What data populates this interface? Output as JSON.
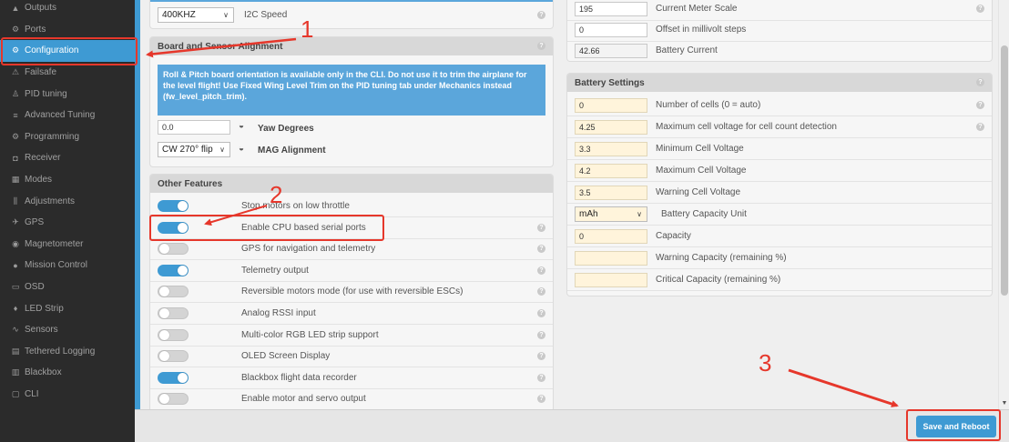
{
  "sidebar": {
    "items": [
      {
        "label": "Outputs",
        "icon": "outputs-icon",
        "glyph": "▲"
      },
      {
        "label": "Ports",
        "icon": "ports-icon",
        "glyph": "⚙"
      },
      {
        "label": "Configuration",
        "icon": "gear-icon",
        "glyph": "⚙",
        "active": true
      },
      {
        "label": "Failsafe",
        "icon": "failsafe-icon",
        "glyph": "⚠"
      },
      {
        "label": "PID tuning",
        "icon": "pid-icon",
        "glyph": "♙"
      },
      {
        "label": "Advanced Tuning",
        "icon": "advanced-tuning-icon",
        "glyph": "≡"
      },
      {
        "label": "Programming",
        "icon": "programming-icon",
        "glyph": "⚙"
      },
      {
        "label": "Receiver",
        "icon": "receiver-icon",
        "glyph": "◘"
      },
      {
        "label": "Modes",
        "icon": "modes-icon",
        "glyph": "▦"
      },
      {
        "label": "Adjustments",
        "icon": "adjustments-icon",
        "glyph": "⫼"
      },
      {
        "label": "GPS",
        "icon": "gps-icon",
        "glyph": "✈"
      },
      {
        "label": "Magnetometer",
        "icon": "magnetometer-icon",
        "glyph": "◉"
      },
      {
        "label": "Mission Control",
        "icon": "mission-control-icon",
        "glyph": "●"
      },
      {
        "label": "OSD",
        "icon": "osd-icon",
        "glyph": "▭"
      },
      {
        "label": "LED Strip",
        "icon": "led-strip-icon",
        "glyph": "♦"
      },
      {
        "label": "Sensors",
        "icon": "sensors-icon",
        "glyph": "∿"
      },
      {
        "label": "Tethered Logging",
        "icon": "tethered-logging-icon",
        "glyph": "▤"
      },
      {
        "label": "Blackbox",
        "icon": "blackbox-icon",
        "glyph": "▥"
      },
      {
        "label": "CLI",
        "icon": "cli-icon",
        "glyph": "▢"
      }
    ]
  },
  "i2c": {
    "speed_value": "400KHZ",
    "label": "I2C Speed"
  },
  "alignment": {
    "title": "Board and Sensor Alignment",
    "note": "Roll & Pitch board orientation is available only in the CLI. Do not use it to trim the airplane for the level flight! Use Fixed Wing Level Trim on the PID tuning tab under Mechanics instead (fw_level_pitch_trim).",
    "yaw_value": "0.0",
    "yaw_label": "Yaw Degrees",
    "mag_value": "CW 270° flip",
    "mag_label": "MAG Alignment"
  },
  "features": {
    "title": "Other Features",
    "items": [
      {
        "label": "Stop motors on low throttle",
        "on": true
      },
      {
        "label": "Enable CPU based serial ports",
        "on": true
      },
      {
        "label": "GPS for navigation and telemetry",
        "on": false
      },
      {
        "label": "Telemetry output",
        "on": true
      },
      {
        "label": "Reversible motors mode (for use with reversible ESCs)",
        "on": false
      },
      {
        "label": "Analog RSSI input",
        "on": false
      },
      {
        "label": "Multi-color RGB LED strip support",
        "on": false
      },
      {
        "label": "OLED Screen Display",
        "on": false
      },
      {
        "label": "Blackbox flight data recorder",
        "on": true
      },
      {
        "label": "Enable motor and servo output",
        "on": false
      }
    ]
  },
  "current": {
    "scale_value": "195",
    "scale_label": "Current Meter Scale",
    "offset_value": "0",
    "offset_label": "Offset in millivolt steps",
    "battery_current_value": "42.66",
    "battery_current_label": "Battery Current"
  },
  "battery": {
    "title": "Battery Settings",
    "cells_value": "0",
    "cells_label": "Number of cells (0 = auto)",
    "max_detect_value": "4.25",
    "max_detect_label": "Maximum cell voltage for cell count detection",
    "min_value": "3.3",
    "min_label": "Minimum Cell Voltage",
    "max_value": "4.2",
    "max_label": "Maximum Cell Voltage",
    "warn_value": "3.5",
    "warn_label": "Warning Cell Voltage",
    "unit_value": "mAh",
    "unit_label": "Battery Capacity Unit",
    "capacity_value": "0",
    "capacity_label": "Capacity",
    "warn_cap_value": "",
    "warn_cap_label": "Warning Capacity (remaining %)",
    "crit_cap_value": "",
    "crit_cap_label": "Critical Capacity (remaining %)"
  },
  "footer": {
    "save_label": "Save and Reboot"
  },
  "annotations": {
    "n1": "1",
    "n2": "2",
    "n3": "3"
  },
  "colors": {
    "accent": "#3e9ad3",
    "annotation": "#e6372b",
    "sidebar": "#2b2b2b"
  }
}
